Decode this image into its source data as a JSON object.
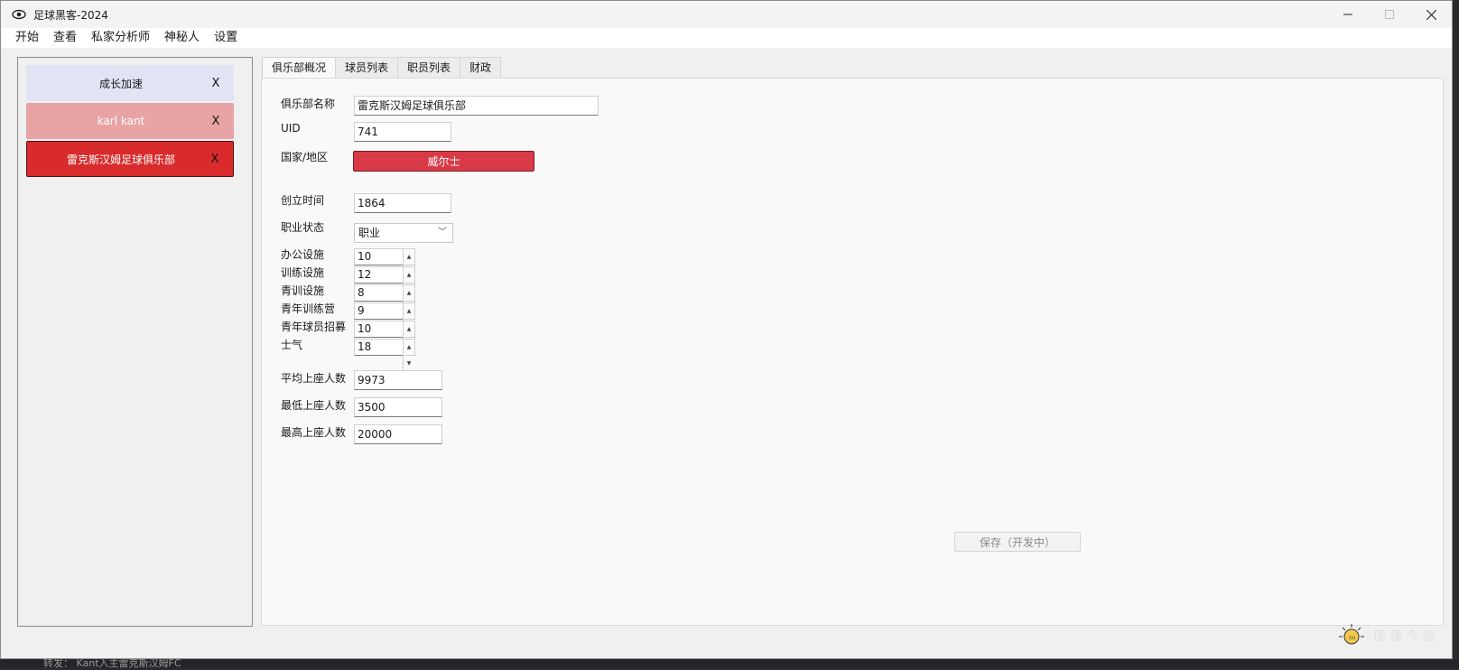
{
  "window": {
    "title": "足球黑客-2024"
  },
  "menu": [
    "开始",
    "查看",
    "私家分析师",
    "神秘人",
    "设置"
  ],
  "sidebar": {
    "cards": [
      {
        "label": "成长加速",
        "close": "X"
      },
      {
        "label": "karl kant",
        "close": "X"
      },
      {
        "label": "雷克斯汉姆足球俱乐部",
        "close": "X"
      }
    ]
  },
  "tabs": [
    "俱乐部概况",
    "球员列表",
    "职员列表",
    "财政"
  ],
  "club": {
    "name_label": "俱乐部名称",
    "name": "雷克斯汉姆足球俱乐部",
    "uid_label": "UID",
    "uid": "741",
    "country_label": "国家/地区",
    "country": "威尔士",
    "founded_label": "创立时间",
    "founded": "1864",
    "status_label": "职业状态",
    "status": "职业",
    "facilities": [
      {
        "label": "办公设施",
        "value": "10"
      },
      {
        "label": "训练设施",
        "value": "12"
      },
      {
        "label": "青训设施",
        "value": "8"
      },
      {
        "label": "青年训练营",
        "value": "9"
      },
      {
        "label": "青年球员招募",
        "value": "10"
      },
      {
        "label": "士气",
        "value": "18"
      }
    ],
    "avg_label": "平均上座人数",
    "avg": "9973",
    "min_label": "最低上座人数",
    "min": "3500",
    "max_label": "最高上座人数",
    "max": "20000"
  },
  "save_label": "保存（开发中）",
  "watermark": "懂 懂 今 值",
  "background_text": "转发： Kant入主雷克斯汉姆FC"
}
